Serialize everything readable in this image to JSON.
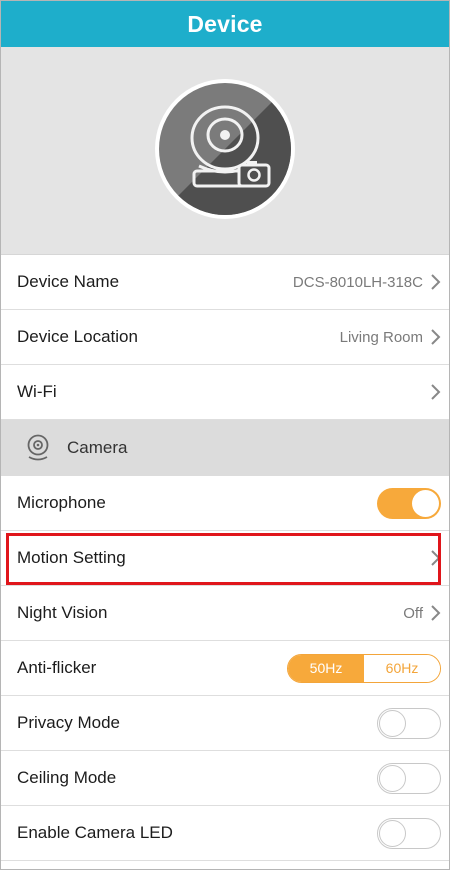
{
  "header": {
    "title": "Device"
  },
  "rows_top": [
    {
      "label": "Device Name",
      "value": "DCS-8010LH-318C"
    },
    {
      "label": "Device Location",
      "value": "Living Room"
    },
    {
      "label": "Wi-Fi",
      "value": ""
    }
  ],
  "section": {
    "label": "Camera",
    "icon": "camera-icon"
  },
  "microphone": {
    "label": "Microphone",
    "on": true
  },
  "motion": {
    "label": "Motion Setting"
  },
  "night_vision": {
    "label": "Night Vision",
    "value": "Off"
  },
  "anti_flicker": {
    "label": "Anti-flicker",
    "options": [
      "50Hz",
      "60Hz"
    ],
    "selected": "50Hz"
  },
  "privacy": {
    "label": "Privacy Mode",
    "on": false
  },
  "ceiling": {
    "label": "Ceiling Mode",
    "on": false
  },
  "led": {
    "label": "Enable Camera LED",
    "on": false
  },
  "colors": {
    "header": "#1eaecb",
    "accent": "#f7a93b",
    "highlight": "#e0151b"
  }
}
